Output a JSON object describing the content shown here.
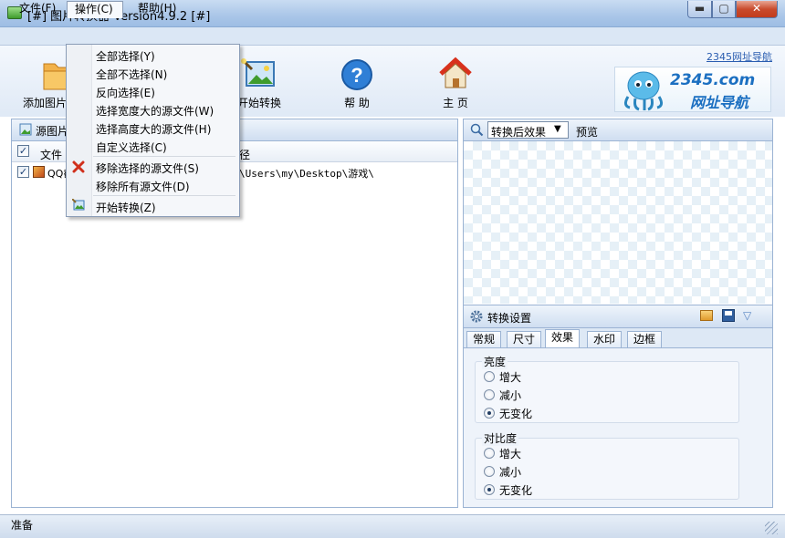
{
  "window": {
    "title": "[#] 图片转换器 Version4.9.2 [#]",
    "min": "▬",
    "max": "▢",
    "close": "✕"
  },
  "menu": {
    "file": "文件(F)",
    "operate": "操作(C)",
    "help": "帮助(H)"
  },
  "toolbar": {
    "add": "添加图片",
    "start": "开始转换",
    "help": "帮 助",
    "home": "主 页",
    "ad_link": "2345网址导航",
    "ad_logo": "2345.com",
    "ad_text": "网址导航"
  },
  "dropdown": {
    "items": [
      "全部选择(Y)",
      "全部不选择(N)",
      "反向选择(E)",
      "选择宽度大的源文件(W)",
      "选择高度大的源文件(H)",
      "自定义选择(C)",
      "移除选择的源文件(S)",
      "移除所有源文件(D)",
      "开始转换(Z)"
    ]
  },
  "left_panel": {
    "title": "源图片",
    "columns": [
      "文件",
      "径"
    ],
    "rows": [
      {
        "name": "QQ截",
        "path": "\\Users\\my\\Desktop\\游戏\\"
      }
    ]
  },
  "right_panel": {
    "select_value": "转换后效果",
    "preview_label": "预览",
    "settings_title": "转换设置",
    "tabs": [
      "常规",
      "尺寸",
      "效果",
      "水印",
      "边框"
    ],
    "active_tab": "效果",
    "brightness": {
      "label": "亮度",
      "options": [
        "增大",
        "减小",
        "无变化"
      ],
      "selected": "无变化"
    },
    "contrast": {
      "label": "对比度",
      "options": [
        "增大",
        "减小",
        "无变化"
      ],
      "selected": "无变化"
    }
  },
  "status": {
    "text": "准备"
  }
}
